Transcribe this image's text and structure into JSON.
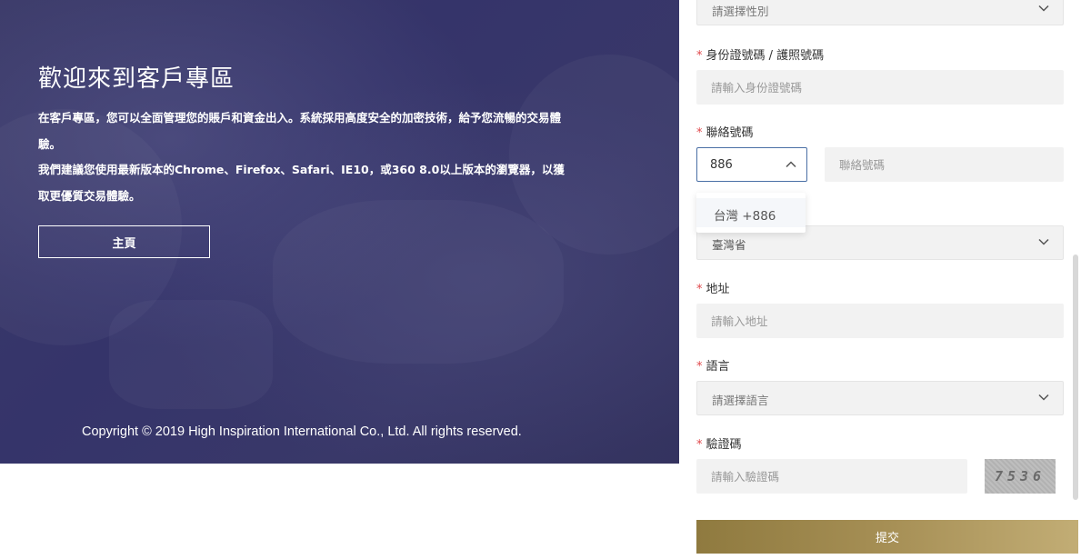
{
  "banner": {
    "title": "歡迎來到客戶專區",
    "desc_line1": "在客戶專區，您可以全面管理您的賬戶和資金出入。系統採用高度安全的加密技術，給予您流暢的交易體驗。",
    "desc_line2": "我們建議您使用最新版本的Chrome、Firefox、Safari、IE10，或360 8.0以上版本的瀏覽器，以獲取更優質交易體驗。",
    "home_button": "主頁",
    "copyright": "Copyright © 2019 High Inspiration International Co., Ltd. All rights reserved."
  },
  "form": {
    "gender": {
      "value": "請選擇性別"
    },
    "id_number": {
      "label": "身份證號碼 / 護照號碼",
      "placeholder": "請輸入身份證號碼"
    },
    "phone": {
      "label": "聯絡號碼",
      "code_value": "886",
      "placeholder": "聯絡號碼",
      "dropdown_option": "台灣 +886"
    },
    "province": {
      "value": "臺灣省"
    },
    "address": {
      "label": "地址",
      "placeholder": "請輸入地址"
    },
    "language": {
      "label": "語言",
      "value": "請選擇語言"
    },
    "captcha": {
      "label": "驗證碼",
      "placeholder": "請輸入驗證碼",
      "image_text": "7536"
    },
    "required_mark": "*",
    "submit_label": "提交"
  },
  "colors": {
    "banner_bg": "#3a3968",
    "required": "#e0484b",
    "submit_gradient_start": "#8f7a3f",
    "submit_gradient_end": "#c2ad75",
    "input_bg": "#f2f2f2",
    "focus_border": "#4a6fa5"
  }
}
